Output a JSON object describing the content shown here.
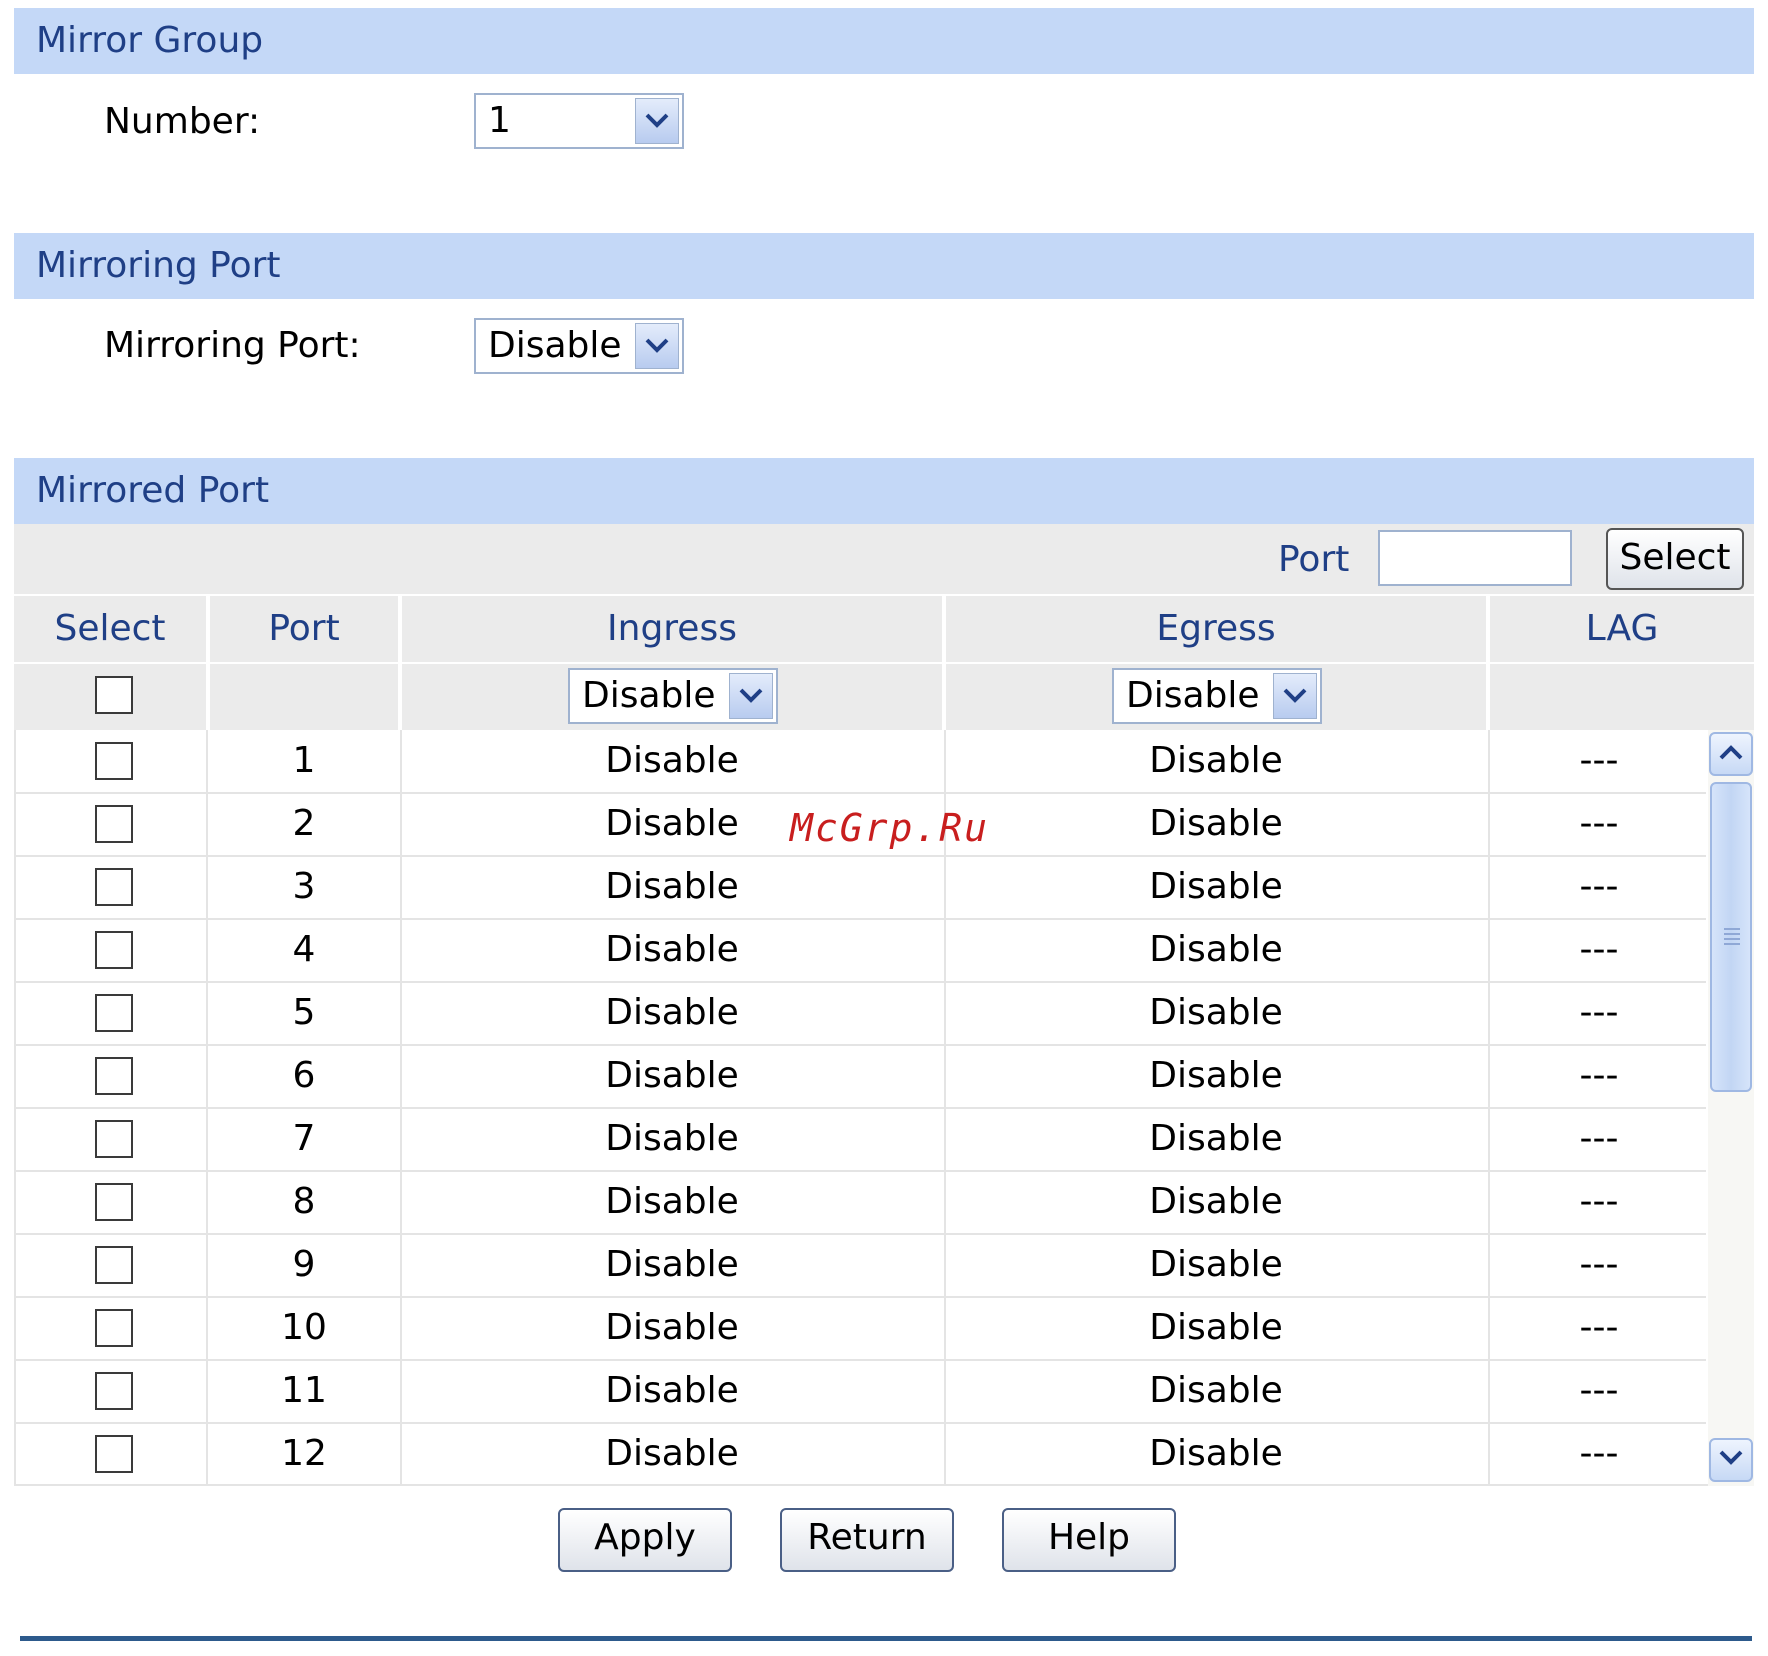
{
  "mirror_group": {
    "title": "Mirror Group",
    "number_label": "Number:",
    "number_value": "1"
  },
  "mirroring_port": {
    "title": "Mirroring Port",
    "label": "Mirroring Port:",
    "value": "Disable"
  },
  "mirrored_port": {
    "title": "Mirrored Port",
    "port_filter_label": "Port",
    "port_filter_value": "",
    "select_button": "Select",
    "columns": [
      "Select",
      "Port",
      "Ingress",
      "Egress",
      "LAG"
    ],
    "ingress_all": "Disable",
    "egress_all": "Disable",
    "rows": [
      {
        "port": "1",
        "ingress": "Disable",
        "egress": "Disable",
        "lag": "---"
      },
      {
        "port": "2",
        "ingress": "Disable",
        "egress": "Disable",
        "lag": "---"
      },
      {
        "port": "3",
        "ingress": "Disable",
        "egress": "Disable",
        "lag": "---"
      },
      {
        "port": "4",
        "ingress": "Disable",
        "egress": "Disable",
        "lag": "---"
      },
      {
        "port": "5",
        "ingress": "Disable",
        "egress": "Disable",
        "lag": "---"
      },
      {
        "port": "6",
        "ingress": "Disable",
        "egress": "Disable",
        "lag": "---"
      },
      {
        "port": "7",
        "ingress": "Disable",
        "egress": "Disable",
        "lag": "---"
      },
      {
        "port": "8",
        "ingress": "Disable",
        "egress": "Disable",
        "lag": "---"
      },
      {
        "port": "9",
        "ingress": "Disable",
        "egress": "Disable",
        "lag": "---"
      },
      {
        "port": "10",
        "ingress": "Disable",
        "egress": "Disable",
        "lag": "---"
      },
      {
        "port": "11",
        "ingress": "Disable",
        "egress": "Disable",
        "lag": "---"
      },
      {
        "port": "12",
        "ingress": "Disable",
        "egress": "Disable",
        "lag": "---"
      }
    ]
  },
  "buttons": {
    "apply": "Apply",
    "return": "Return",
    "help": "Help"
  },
  "watermark": "McGrp.Ru",
  "icons": {
    "dropdown_arrow": "chevron-down-icon",
    "scroll_up": "chevron-up-icon",
    "scroll_down": "chevron-down-icon",
    "scroll_grip": "grip-lines-icon"
  },
  "colors": {
    "section_header_bg": "#c4d8f7",
    "section_header_text": "#1f3f86",
    "table_header_bg": "#ebebeb",
    "bottom_rule": "#2d5a8c"
  }
}
